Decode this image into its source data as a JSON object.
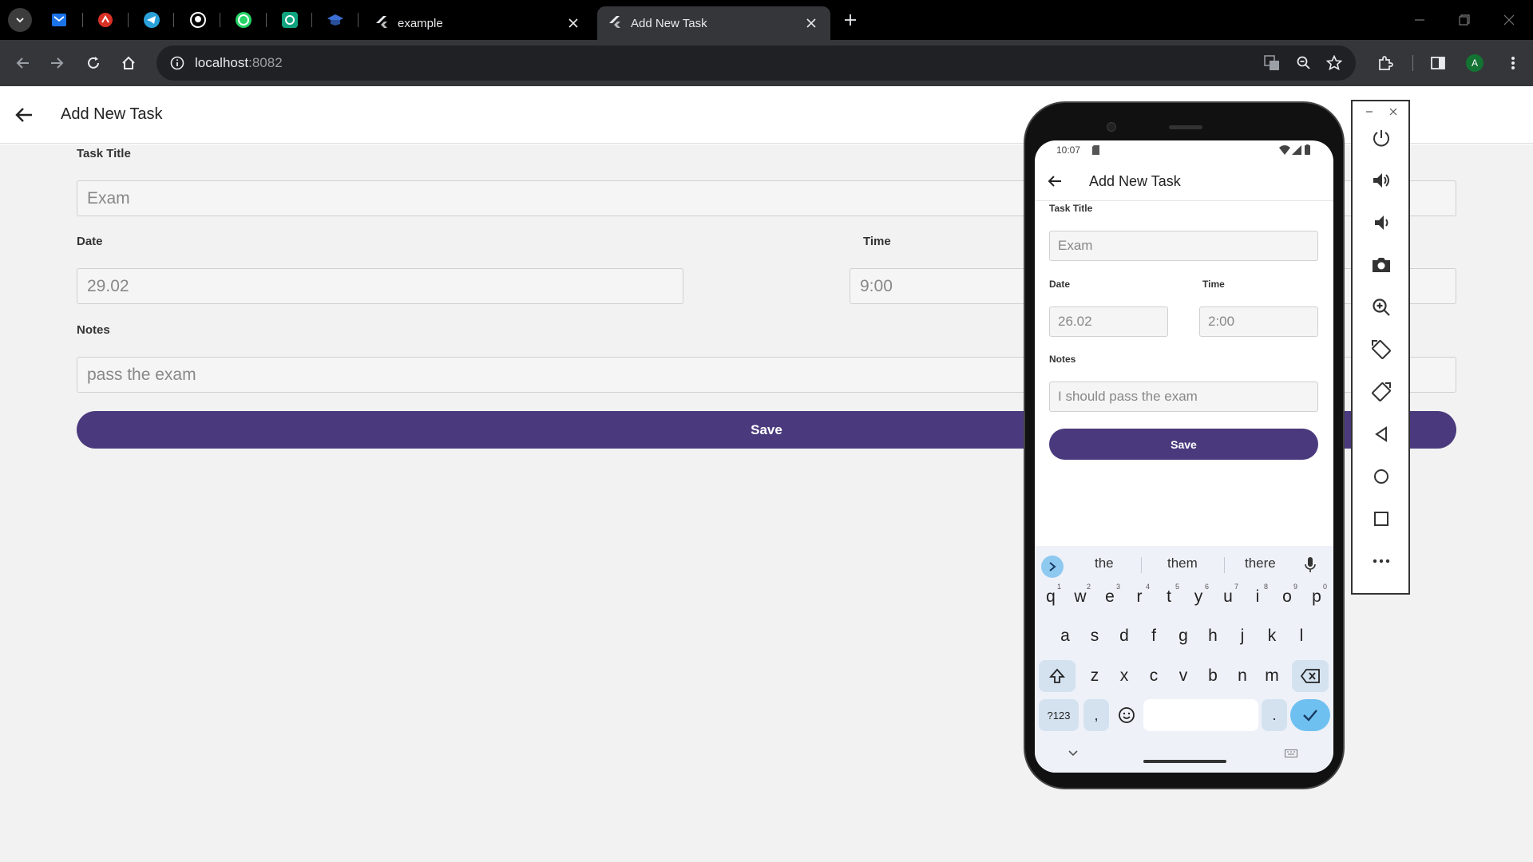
{
  "browser": {
    "tabs": [
      {
        "title": "example",
        "active": false
      },
      {
        "title": "Add New Task",
        "active": true
      }
    ],
    "pinned_tabs": [
      "mail-icon",
      "app-icon",
      "telegram-icon",
      "github-icon",
      "whatsapp-icon",
      "chatgpt-icon",
      "graduation-icon"
    ],
    "address_host": "localhost",
    "address_port": ":8082",
    "profile_initial": "A"
  },
  "app": {
    "title": "Add New Task",
    "task_title_label": "Task Title",
    "task_title_value": "Exam",
    "date_label": "Date",
    "date_value": "29.02",
    "time_label": "Time",
    "time_value": "9:00",
    "notes_label": "Notes",
    "notes_value": "pass the exam",
    "save_label": "Save",
    "accent": "#4a3a7d"
  },
  "phone": {
    "status_time": "10:07",
    "title": "Add New Task",
    "task_title_label": "Task Title",
    "task_title_value": "Exam",
    "date_label": "Date",
    "date_value": "26.02",
    "time_label": "Time",
    "time_value": "2:00",
    "notes_label": "Notes",
    "notes_value": "I should pass the exam",
    "save_label": "Save",
    "keyboard": {
      "suggestions": [
        "the",
        "them",
        "there"
      ],
      "row1": [
        "q",
        "w",
        "e",
        "r",
        "t",
        "y",
        "u",
        "i",
        "o",
        "p"
      ],
      "row1_digits": [
        "1",
        "2",
        "3",
        "4",
        "5",
        "6",
        "7",
        "8",
        "9",
        "0"
      ],
      "row2": [
        "a",
        "s",
        "d",
        "f",
        "g",
        "h",
        "j",
        "k",
        "l"
      ],
      "row3": [
        "z",
        "x",
        "c",
        "v",
        "b",
        "n",
        "m"
      ],
      "symbols_key": "?123",
      "comma_key": ",",
      "period_key": "."
    }
  },
  "emulator_panel": {
    "buttons": [
      "power-icon",
      "volume-up-icon",
      "volume-down-icon",
      "camera-icon",
      "zoom-icon",
      "rotate-left-icon",
      "rotate-right-icon",
      "back-icon",
      "home-icon",
      "overview-icon",
      "more-icon"
    ]
  }
}
